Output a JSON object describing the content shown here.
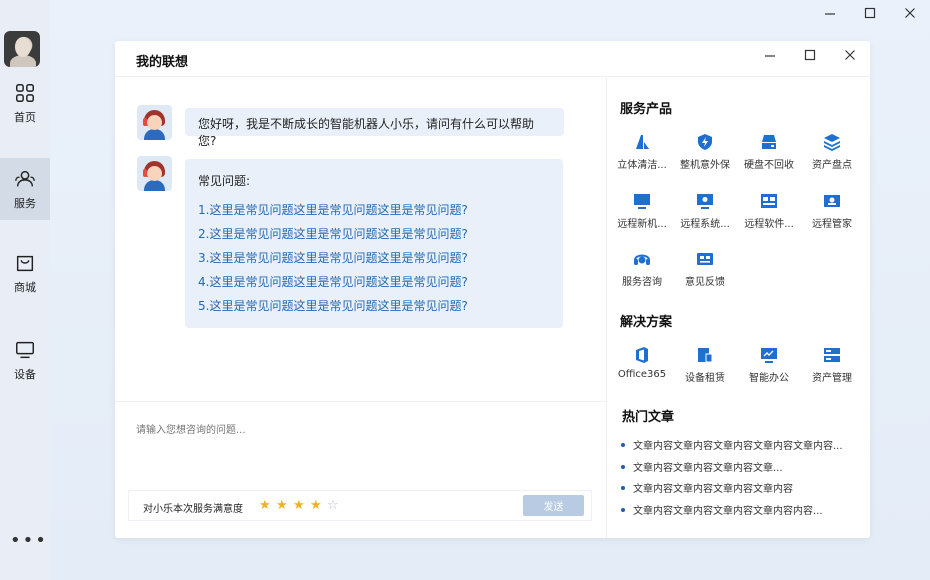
{
  "window": {
    "minimize": "—",
    "maximize": "☐",
    "close": "✕"
  },
  "sidebar": {
    "items": [
      {
        "label": "首页",
        "icon": "grid-icon"
      },
      {
        "label": "服务",
        "icon": "users-icon",
        "active": true
      },
      {
        "label": "商城",
        "icon": "bag-icon"
      },
      {
        "label": "设备",
        "icon": "monitor-icon"
      }
    ],
    "more": "•••"
  },
  "dialog": {
    "title": "我的联想",
    "controls": {
      "minimize": "—",
      "maximize": "☐",
      "close": "✕"
    }
  },
  "chat": {
    "greeting": "您好呀，我是不断成长的智能机器人小乐，请问有什么可以帮助您?",
    "faq_title": "常见问题:",
    "faq": [
      "1.这里是常见问题这里是常见问题这里是常见问题?",
      "2.这里是常见问题这里是常见问题这里是常见问题?",
      "3.这里是常见问题这里是常见问题这里是常见问题?",
      "4.这里是常见问题这里是常见问题这里是常见问题?",
      "5.这里是常见问题这里是常见问题这里是常见问题?"
    ],
    "input_placeholder": "请输入您想咨询的问题...",
    "rating_label": "对小乐本次服务满意度",
    "rating": 4,
    "rating_max": 5,
    "send_label": "发送"
  },
  "right_panel": {
    "services_title": "服务产品",
    "services": [
      "立体清洁...",
      "整机意外保",
      "硬盘不回收",
      "资产盘点",
      "远程新机...",
      "远程系统...",
      "远程软件...",
      "远程管家",
      "服务咨询",
      "意见反馈"
    ],
    "solutions_title": "解决方案",
    "solutions": [
      "Office365",
      "设备租赁",
      "智能办公",
      "资产管理"
    ],
    "articles_title": "热门文章",
    "articles": [
      "文章内容文章内容文章内容文章内容文章内容...",
      "文章内容文章内容文章内容文章...",
      "文章内容文章内容文章内容文章内容",
      "文章内容文章内容文章内容文章内容内容..."
    ]
  },
  "colors": {
    "accent": "#1f5fb8",
    "link": "#2469b5",
    "star": "#f2b01e",
    "send_disabled": "#b8cbe3"
  }
}
